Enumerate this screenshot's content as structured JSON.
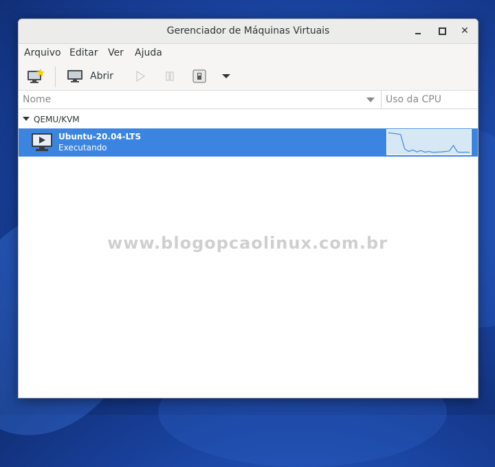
{
  "window": {
    "title": "Gerenciador de Máquinas Virtuais"
  },
  "window_controls": {
    "minimize_icon": "minimize-icon",
    "maximize_icon": "maximize-icon",
    "close_glyph": "✕"
  },
  "menu": [
    "Arquivo",
    "Editar",
    "Ver",
    "Ajuda"
  ],
  "toolbar": {
    "new_vm_icon": "new-vm-icon",
    "open_label": "Abrir",
    "run_icon": "play-icon",
    "pause_icon": "pause-icon",
    "shutdown_icon": "shutdown-icon",
    "dropdown_icon": "chevron-down-icon"
  },
  "columns": {
    "name": "Nome",
    "cpu": "Uso da CPU"
  },
  "groups": [
    {
      "label": "QEMU/KVM",
      "vms": [
        {
          "name": "Ubuntu-20.04-LTS",
          "status": "Executando",
          "cpu_history": [
            92,
            90,
            88,
            85,
            20,
            8,
            15,
            6,
            12,
            5,
            8,
            4,
            5,
            6,
            8,
            10,
            35,
            6,
            4,
            5,
            4
          ]
        }
      ]
    }
  ],
  "watermark": "www.blogopcaolinux.com.br",
  "colors": {
    "selection": "#3b84e0",
    "graph_bg": "#d6e8f3",
    "graph_line": "#3b84e0"
  }
}
